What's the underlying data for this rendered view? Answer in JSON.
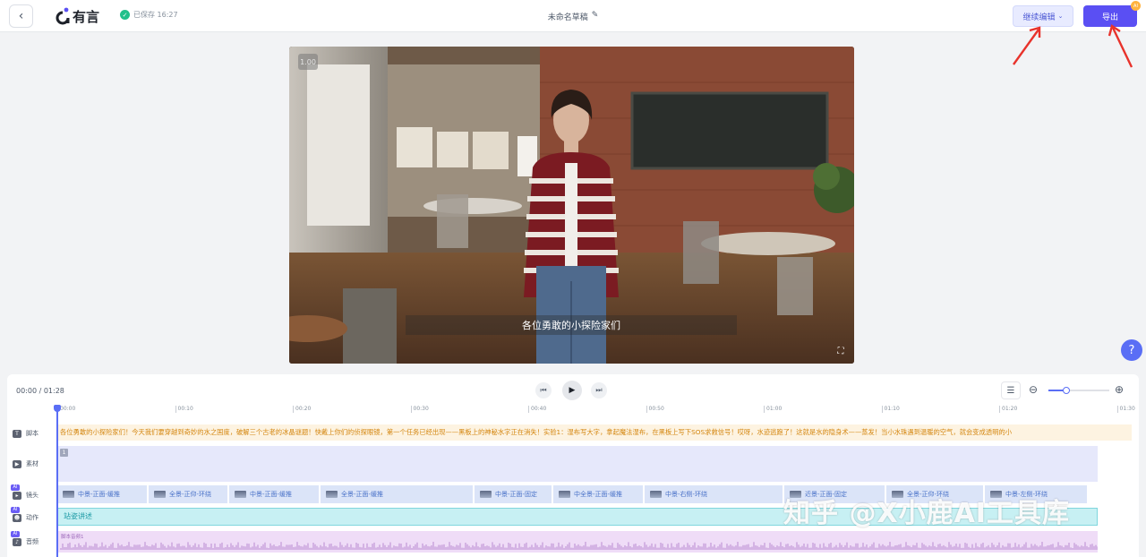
{
  "header": {
    "back_icon": "chevron-left-icon",
    "logo_text": "有言",
    "saved_status": "已保存 16:27",
    "doc_title": "未命名草稿",
    "continue_edit_label": "继续编辑",
    "export_label": "导出",
    "ai_badge": "AI"
  },
  "preview": {
    "speed": "1.00",
    "subtitle": "各位勇敢的小探险家们"
  },
  "player": {
    "time": "00:00 / 01:28",
    "zoom_level": 0.3,
    "help": "?"
  },
  "ruler": {
    "ticks": [
      "00:00",
      "00:10",
      "00:20",
      "00:30",
      "00:40",
      "00:50",
      "01:00",
      "01:10",
      "01:20",
      "01:30"
    ]
  },
  "tracks": {
    "script_label": "脚本",
    "material_label": "素材",
    "camera_label": "镜头",
    "action_label": "动作",
    "audio_label": "音频",
    "script_text": "各位勇敢的小探险家们！今天我们要穿越到奇妙的水之国度，破解三个古老的冰晶谜题！快戴上你们的侦探眼镜，第一个任务已经出现——黑板上的神秘水字正在消失！实验1：湿布写大字，拿起魔法湿布，在黑板上写下SOS求救信号！哎呀，水迹逃跑了！这就是水的隐身术——蒸发！当小水珠遇到温暖的空气，就会变成透明的小",
    "material_badge": "1",
    "camera_segments": [
      "中景-正面-缓推",
      "全景-正仰-环绕",
      "中景-正面-缓推",
      "全景-正面-缓推",
      "中景-正面-固定",
      "中全景-正面-缓推",
      "中景-右侧-环绕",
      "近景-正面-固定",
      "全景-正仰-环绕",
      "中景-左侧-环绕"
    ],
    "action_text": "站姿讲述",
    "audio_text": "脚本音频1"
  },
  "watermark": "知乎 @X小鹿AI工具库"
}
